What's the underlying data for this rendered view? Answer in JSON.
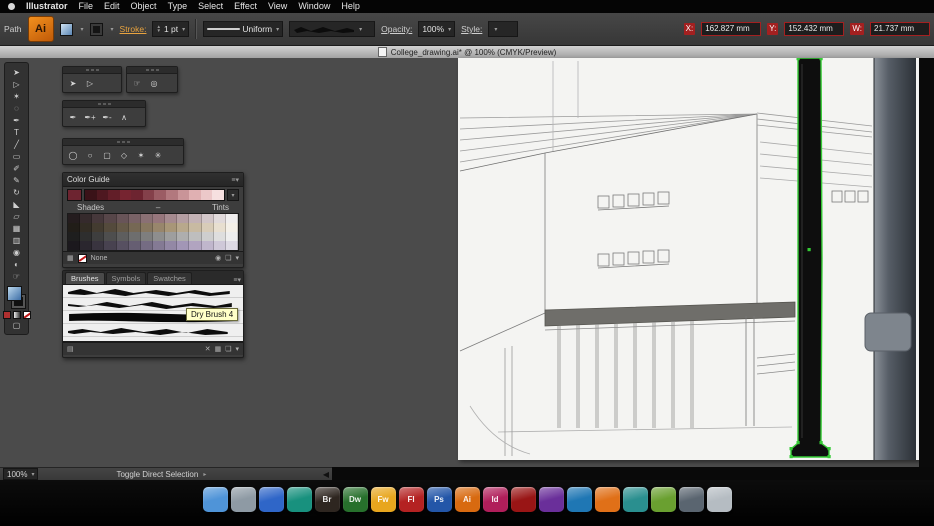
{
  "colors": {
    "selection_green": "#35cb35",
    "chip_red": "#a32020",
    "stroke_link_orange": "#e8a33f"
  },
  "menubar": {
    "app_name": "Illustrator",
    "items": [
      "File",
      "Edit",
      "Object",
      "Type",
      "Select",
      "Effect",
      "View",
      "Window",
      "Help"
    ]
  },
  "control_bar": {
    "object_type": "Path",
    "logo_text": "Ai",
    "stroke_label": "Stroke:",
    "stroke_weight": "1 pt",
    "width_profile": "Uniform",
    "opacity_label": "Opacity:",
    "opacity_value": "100%",
    "style_label": "Style:",
    "x_label": "X:",
    "x_value": "162.827 mm",
    "y_label": "Y:",
    "y_value": "152.432 mm",
    "w_label": "W:",
    "w_value": "21.737 mm"
  },
  "document_bar": {
    "title": "College_drawing.ai* @ 100% (CMYK/Preview)"
  },
  "toolbar": {
    "tools": [
      {
        "name": "selection-tool",
        "glyph": "➤"
      },
      {
        "name": "direct-selection-tool",
        "glyph": "▷"
      },
      {
        "name": "magic-wand-tool",
        "glyph": "✶"
      },
      {
        "name": "lasso-tool",
        "glyph": "◌"
      },
      {
        "name": "pen-tool",
        "glyph": "✒"
      },
      {
        "name": "type-tool",
        "glyph": "T"
      },
      {
        "name": "line-segment-tool",
        "glyph": "╱"
      },
      {
        "name": "rectangle-tool",
        "glyph": "▭"
      },
      {
        "name": "paintbrush-tool",
        "glyph": "✐"
      },
      {
        "name": "pencil-tool",
        "glyph": "✎"
      },
      {
        "name": "rotate-tool",
        "glyph": "↻"
      },
      {
        "name": "scale-tool",
        "glyph": "◣"
      },
      {
        "name": "free-transform-tool",
        "glyph": "▱"
      },
      {
        "name": "mesh-tool",
        "glyph": "▦"
      },
      {
        "name": "gradient-tool",
        "glyph": "▥"
      },
      {
        "name": "eyedropper-tool",
        "glyph": "◉"
      },
      {
        "name": "blend-tool",
        "glyph": "◐"
      },
      {
        "name": "hand-tool",
        "glyph": "☞"
      }
    ]
  },
  "tool_panels": {
    "selection": [
      {
        "name": "selection-tool",
        "glyph": "➤"
      },
      {
        "name": "direct-selection-tool",
        "glyph": "▷"
      }
    ],
    "navigation": [
      {
        "name": "hand-tool",
        "glyph": "☞"
      },
      {
        "name": "zoom-tool",
        "glyph": "◎"
      }
    ],
    "pen": [
      {
        "name": "pen-tool",
        "glyph": "✒"
      },
      {
        "name": "add-anchor-point-tool",
        "glyph": "✒+"
      },
      {
        "name": "delete-anchor-point-tool",
        "glyph": "✒-"
      },
      {
        "name": "convert-anchor-point-tool",
        "glyph": "∧"
      }
    ],
    "shape": [
      {
        "name": "ellipse-tool",
        "glyph": "◯"
      },
      {
        "name": "circle-tool",
        "glyph": "○"
      },
      {
        "name": "rounded-rectangle-tool",
        "glyph": "▢"
      },
      {
        "name": "polygon-tool",
        "glyph": "◇"
      },
      {
        "name": "star-tool",
        "glyph": "✶"
      },
      {
        "name": "flare-tool",
        "glyph": "✳"
      }
    ]
  },
  "color_guide": {
    "title": "Color Guide",
    "base_color": "#6d2430",
    "variations": [
      "#3a1218",
      "#4e1820",
      "#621e28",
      "#762430",
      "#6d2430",
      "#84404a",
      "#9b5c64",
      "#b2787e",
      "#c99498",
      "#e0b0b2",
      "#ecc8c9",
      "#f6e0e0"
    ],
    "shades_label": "Shades",
    "separator": "–",
    "tints_label": "Tints",
    "rows": [
      [
        "#241c1e",
        "#352a2c",
        "#46383b",
        "#574649",
        "#685458",
        "#796266",
        "#8a7074",
        "#96767c",
        "#a58a8f",
        "#b49ea2",
        "#c3b2b5",
        "#d2c6c8",
        "#e1dadb",
        "#f0eeee"
      ],
      [
        "#211d18",
        "#322c24",
        "#433b30",
        "#544a3c",
        "#655948",
        "#766854",
        "#877760",
        "#98866c",
        "#a89678",
        "#b8a88c",
        "#c8baa2",
        "#d8ccb8",
        "#e8dfd0",
        "#f4f0e8"
      ],
      [
        "#1e1e1e",
        "#2e2e2e",
        "#3e3e3e",
        "#4e4e4e",
        "#5e5e5e",
        "#6e6e6e",
        "#7e7e7e",
        "#8e8e8e",
        "#9e9e9e",
        "#aeaeae",
        "#bebebe",
        "#cecece",
        "#dedede",
        "#eeeeee"
      ],
      [
        "#1b181d",
        "#2a262e",
        "#39343f",
        "#484250",
        "#575061",
        "#665e72",
        "#756c83",
        "#847a94",
        "#9388a5",
        "#a296b6",
        "#b1a4c0",
        "#c0b6cc",
        "#cfc8d8",
        "#dedae4"
      ]
    ],
    "none_label": "None"
  },
  "brushes_panel": {
    "tabs": [
      "Brushes",
      "Symbols",
      "Swatches"
    ],
    "active_tab": "Brushes",
    "tooltip": "Dry Brush 4"
  },
  "status_bar": {
    "zoom": "100%",
    "tool_hint": "Toggle Direct Selection"
  },
  "dock": {
    "apps": [
      {
        "name": "finder",
        "color": "#4f94d8",
        "label": ""
      },
      {
        "name": "app-gray",
        "color": "#8e9aa4",
        "label": ""
      },
      {
        "name": "app-blue",
        "color": "#2f66c8",
        "label": ""
      },
      {
        "name": "app-teal",
        "color": "#18917e",
        "label": ""
      },
      {
        "name": "bridge",
        "color": "#2e2620",
        "label": "Br"
      },
      {
        "name": "dreamweaver",
        "color": "#27702c",
        "label": "Dw"
      },
      {
        "name": "fireworks",
        "color": "#e8a61e",
        "label": "Fw"
      },
      {
        "name": "flash",
        "color": "#b42222",
        "label": "Fl"
      },
      {
        "name": "photoshop",
        "color": "#2356a8",
        "label": "Ps"
      },
      {
        "name": "illustrator",
        "color": "#d86a10",
        "label": "Ai"
      },
      {
        "name": "indesign",
        "color": "#b01e5a",
        "label": "Id"
      },
      {
        "name": "acrobat",
        "color": "#991515",
        "label": ""
      },
      {
        "name": "app-purple",
        "color": "#6a2f9a",
        "label": ""
      },
      {
        "name": "app-lightblue",
        "color": "#1f77b4",
        "label": ""
      },
      {
        "name": "app-orange",
        "color": "#e07018",
        "label": ""
      },
      {
        "name": "app-cyan",
        "color": "#2a8f8f",
        "label": ""
      },
      {
        "name": "app-green",
        "color": "#6aa030",
        "label": ""
      },
      {
        "name": "app-slate",
        "color": "#5a6570",
        "label": ""
      },
      {
        "name": "trash",
        "color": "#b5bcc2",
        "label": ""
      }
    ]
  }
}
